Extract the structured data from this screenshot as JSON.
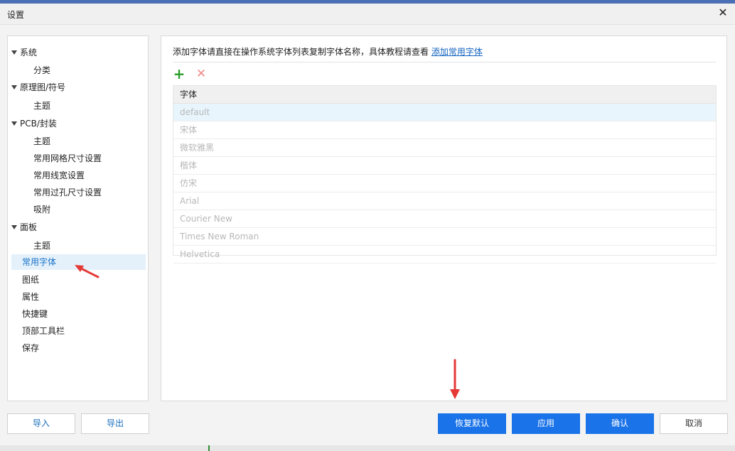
{
  "window": {
    "title": "设置"
  },
  "icons": {
    "close": "close-icon",
    "add": "plus-icon",
    "delete": "delete-icon",
    "expand": "expand-triangle-icon"
  },
  "colors": {
    "accent": "#1a73e8",
    "link": "#1565c0",
    "selected_bg": "#e4f1fb",
    "add_green": "#2a9d2a",
    "delete_red": "#f08a8a",
    "annotation_red": "#e53935"
  },
  "sidebar": {
    "items": [
      {
        "label": "系统",
        "expanded": true
      },
      {
        "label": "分类"
      },
      {
        "label": "原理图/符号",
        "expanded": true
      },
      {
        "label": "主题"
      },
      {
        "label": "PCB/封装",
        "expanded": true
      },
      {
        "label": "主题"
      },
      {
        "label": "常用网格尺寸设置"
      },
      {
        "label": "常用线宽设置"
      },
      {
        "label": "常用过孔尺寸设置"
      },
      {
        "label": "吸附"
      },
      {
        "label": "面板",
        "expanded": true
      },
      {
        "label": "主题"
      },
      {
        "label": "常用字体",
        "selected": true
      },
      {
        "label": "图纸"
      },
      {
        "label": "属性"
      },
      {
        "label": "快捷键"
      },
      {
        "label": "顶部工具栏"
      },
      {
        "label": "保存"
      }
    ]
  },
  "main": {
    "description": "添加字体请直接在操作系统字体列表复制字体名称，具体教程请查看",
    "link_text": "添加常用字体",
    "table": {
      "header": "字体",
      "rows": [
        "default",
        "宋体",
        "微软雅黑",
        "楷体",
        "仿宋",
        "Arial",
        "Courier New",
        "Times New Roman",
        "Helvetica"
      ]
    }
  },
  "footer": {
    "import_label": "导入",
    "export_label": "导出",
    "restore_label": "恢复默认",
    "apply_label": "应用",
    "confirm_label": "确认",
    "cancel_label": "取消"
  }
}
